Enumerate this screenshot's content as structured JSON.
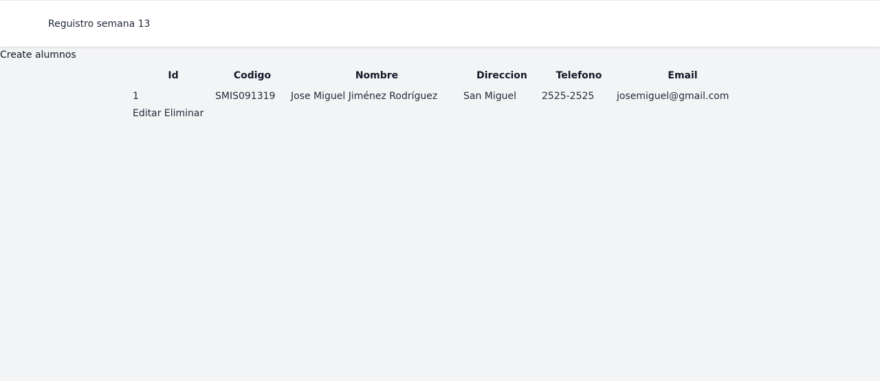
{
  "header": {
    "title": "Reguistro semana 13"
  },
  "main": {
    "create_link": "Create alumnos"
  },
  "table": {
    "columns": [
      "Id",
      "Codigo",
      "Nombre",
      "Direccion",
      "Telefono",
      "Email"
    ],
    "rows": [
      {
        "id": "1",
        "codigo": "SMIS091319",
        "nombre": "Jose Miguel Jiménez Rodríguez",
        "direccion": "San Miguel",
        "telefono": "2525-2525",
        "email": "josemiguel@gmail.com",
        "actions": {
          "edit": "Editar",
          "delete": "Eliminar"
        }
      }
    ]
  },
  "colors": {
    "page_background": "#f3f4f6",
    "header_background": "#ffffff"
  }
}
